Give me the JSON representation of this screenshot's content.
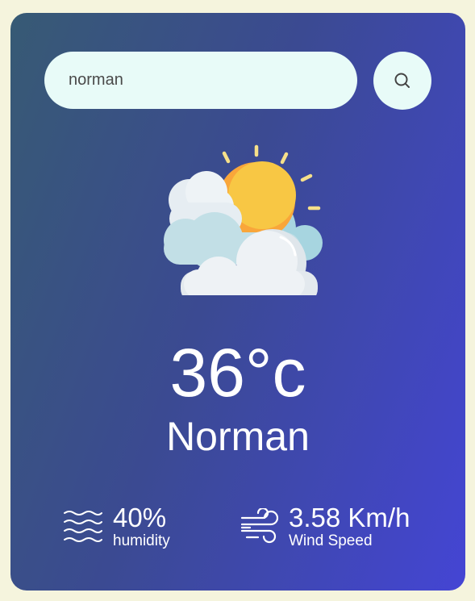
{
  "search": {
    "value": "norman",
    "button_icon": "search-icon"
  },
  "weather": {
    "icon": "partly-cloudy-icon",
    "temperature": "36°c",
    "city": "Norman"
  },
  "stats": {
    "humidity": {
      "value": "40%",
      "label": "humidity",
      "icon": "humidity-icon"
    },
    "wind": {
      "value": "3.58 Km/h",
      "label": "Wind Speed",
      "icon": "wind-icon"
    }
  },
  "colors": {
    "page_background": "#f5f4dd",
    "card_gradient_start": "#375a74",
    "card_gradient_end": "#4445d4",
    "search_background": "#e8fbf8",
    "text": "#ffffff"
  }
}
